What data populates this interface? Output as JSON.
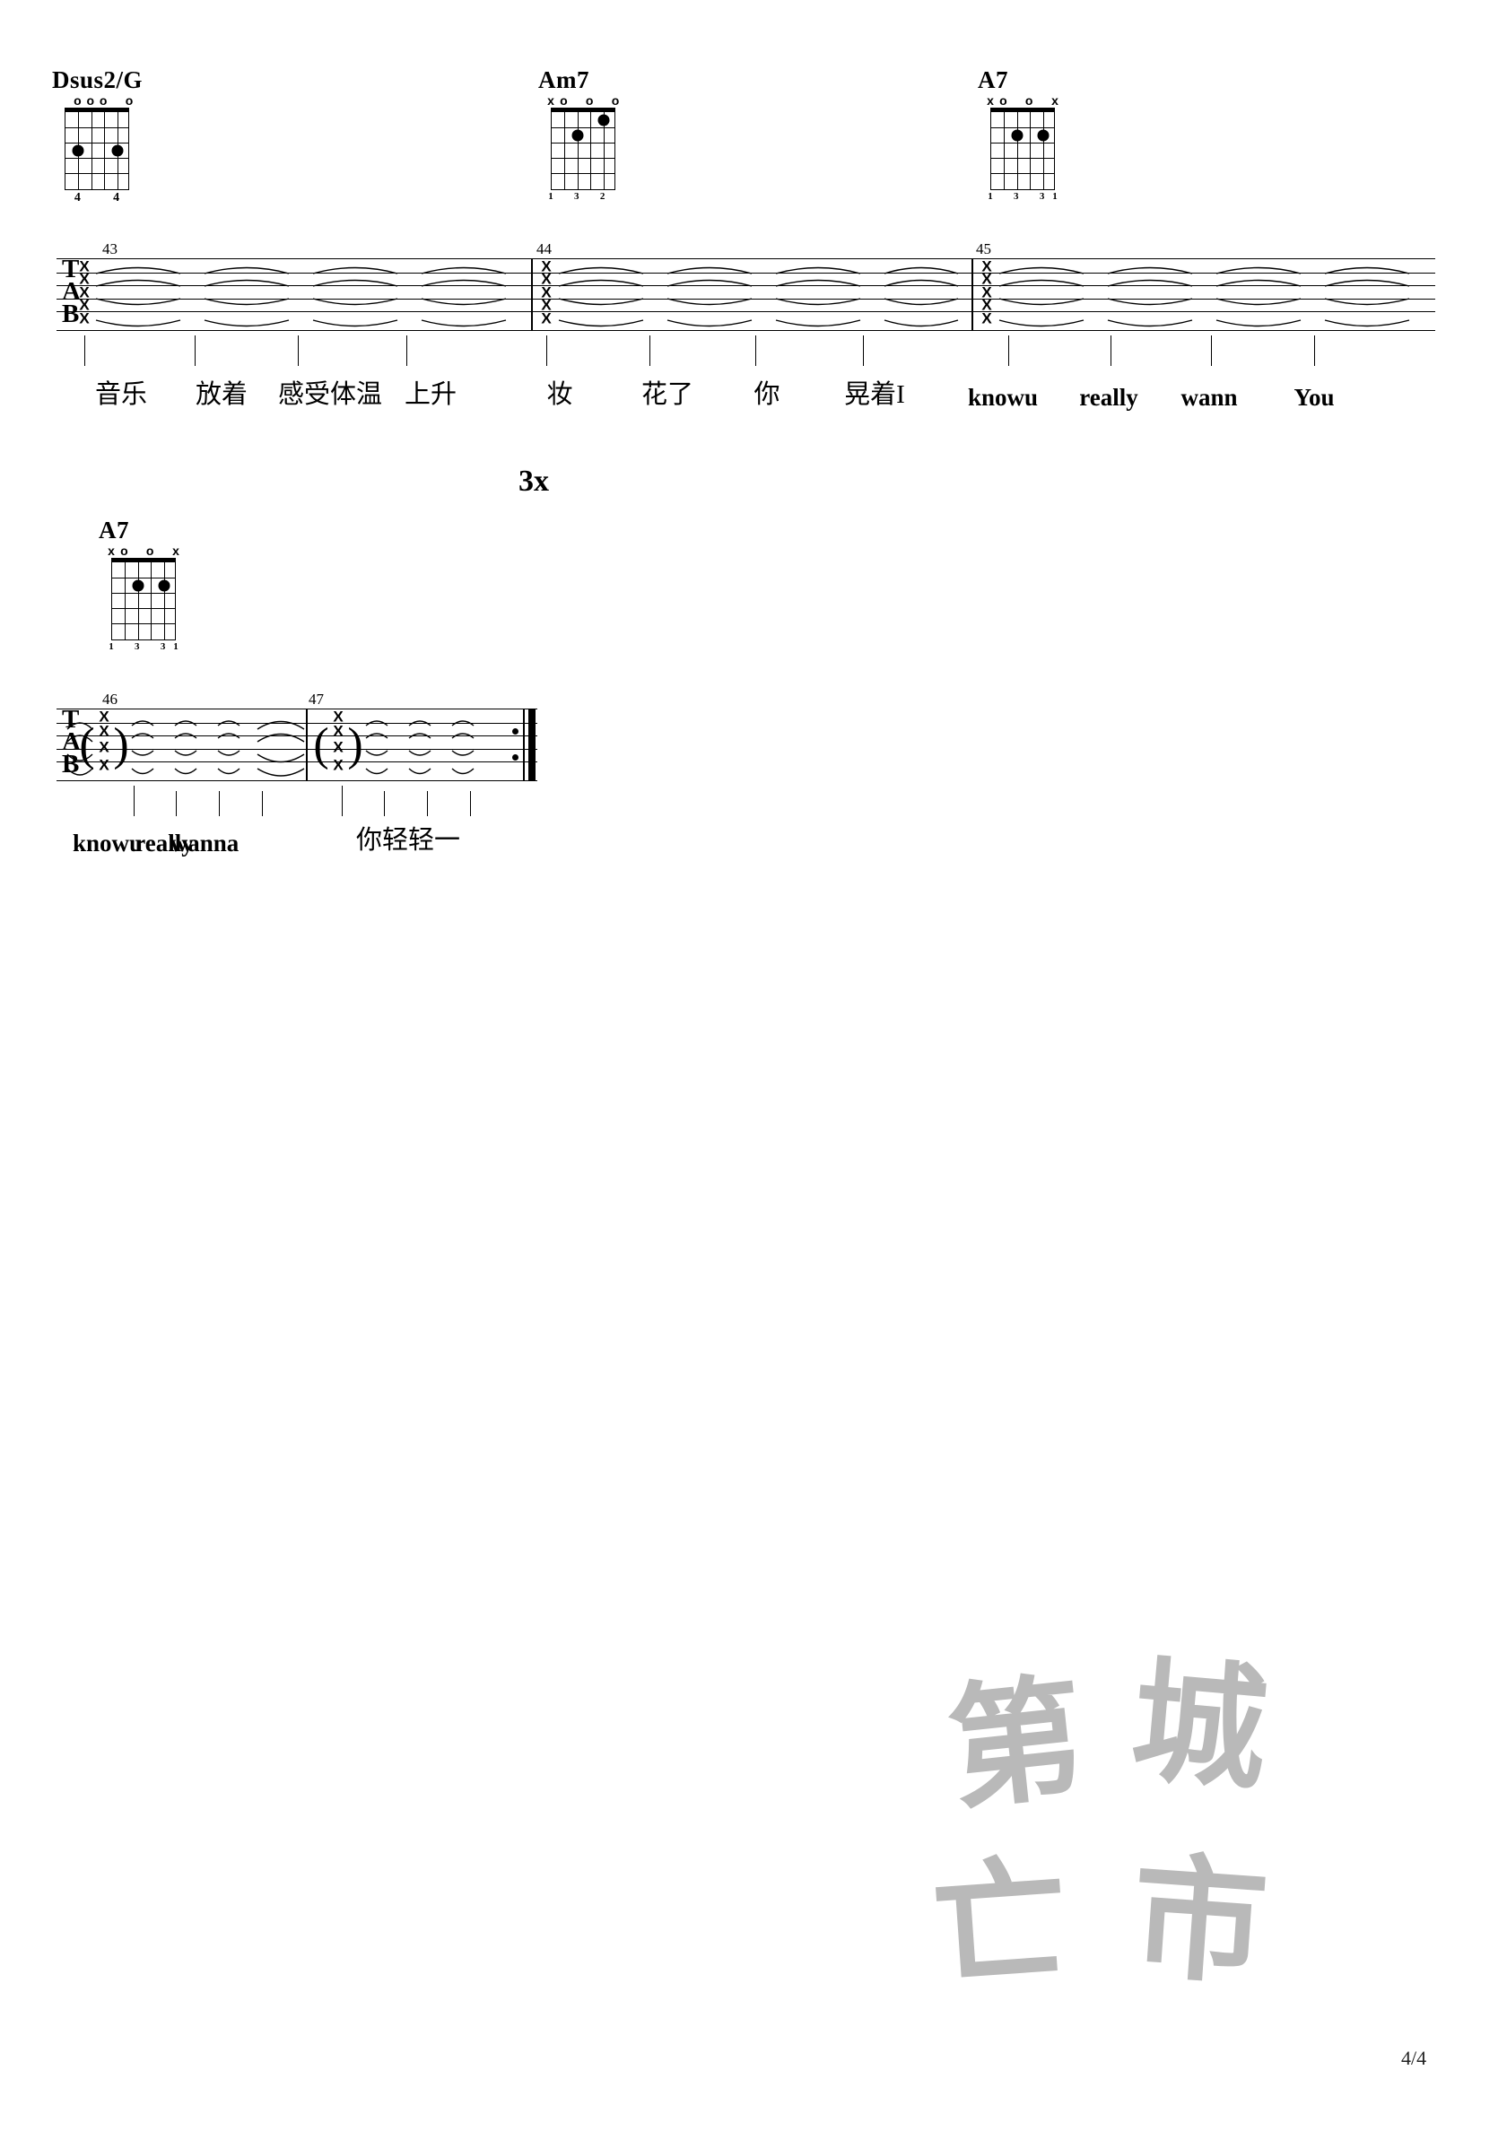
{
  "page": {
    "page_number": "4/4",
    "watermark_characters": [
      "第",
      "城",
      "亡",
      "市"
    ]
  },
  "systems": [
    {
      "id": "system-1",
      "repeats_label": "3x",
      "chords": [
        {
          "name": "Dsus2/G",
          "markers": [
            "",
            "o",
            "o",
            "o",
            "",
            "o"
          ],
          "dots": [
            {
              "string": 5,
              "fret": 3
            },
            {
              "string": 2,
              "fret": 3
            }
          ],
          "fingers": [
            "",
            "4",
            "",
            "",
            "4",
            ""
          ]
        },
        {
          "name": "Am7",
          "markers": [
            "x",
            "o",
            "",
            "o",
            "",
            "o"
          ],
          "dots": [
            {
              "string": 4,
              "fret": 2
            },
            {
              "string": 2,
              "fret": 1
            }
          ],
          "fingers": [
            "1",
            "",
            "3",
            "",
            "2",
            ""
          ]
        },
        {
          "name": "A7",
          "markers": [
            "x",
            "o",
            "",
            "o",
            "",
            "x"
          ],
          "dots": [
            {
              "string": 4,
              "fret": 2
            },
            {
              "string": 2,
              "fret": 2
            }
          ],
          "fingers": [
            "1",
            "",
            "3",
            "",
            "3",
            "1"
          ]
        }
      ],
      "measures": [
        {
          "number": "43",
          "notes": "x",
          "lyrics": [
            "音乐",
            "放着",
            "感受体温",
            "上升"
          ]
        },
        {
          "number": "44",
          "notes": "x",
          "lyrics": [
            "妆",
            "花了",
            "你",
            "晃着I"
          ]
        },
        {
          "number": "45",
          "notes": "x",
          "lyrics": [
            "knowu",
            "really",
            "wann",
            "You"
          ]
        }
      ]
    },
    {
      "id": "system-2",
      "chords": [
        {
          "name": "A7",
          "markers": [
            "x",
            "o",
            "",
            "o",
            "",
            "x"
          ],
          "dots": [
            {
              "string": 4,
              "fret": 2
            },
            {
              "string": 2,
              "fret": 2
            }
          ],
          "fingers": [
            "1",
            "",
            "3",
            "",
            "3",
            "1"
          ]
        }
      ],
      "measures": [
        {
          "number": "46",
          "notes": "(x)",
          "lyrics": [
            "knowu",
            "really",
            "wanna"
          ]
        },
        {
          "number": "47",
          "notes": "(x)",
          "lyrics": [
            "你轻轻一"
          ]
        }
      ],
      "ending": "repeat-end"
    }
  ]
}
